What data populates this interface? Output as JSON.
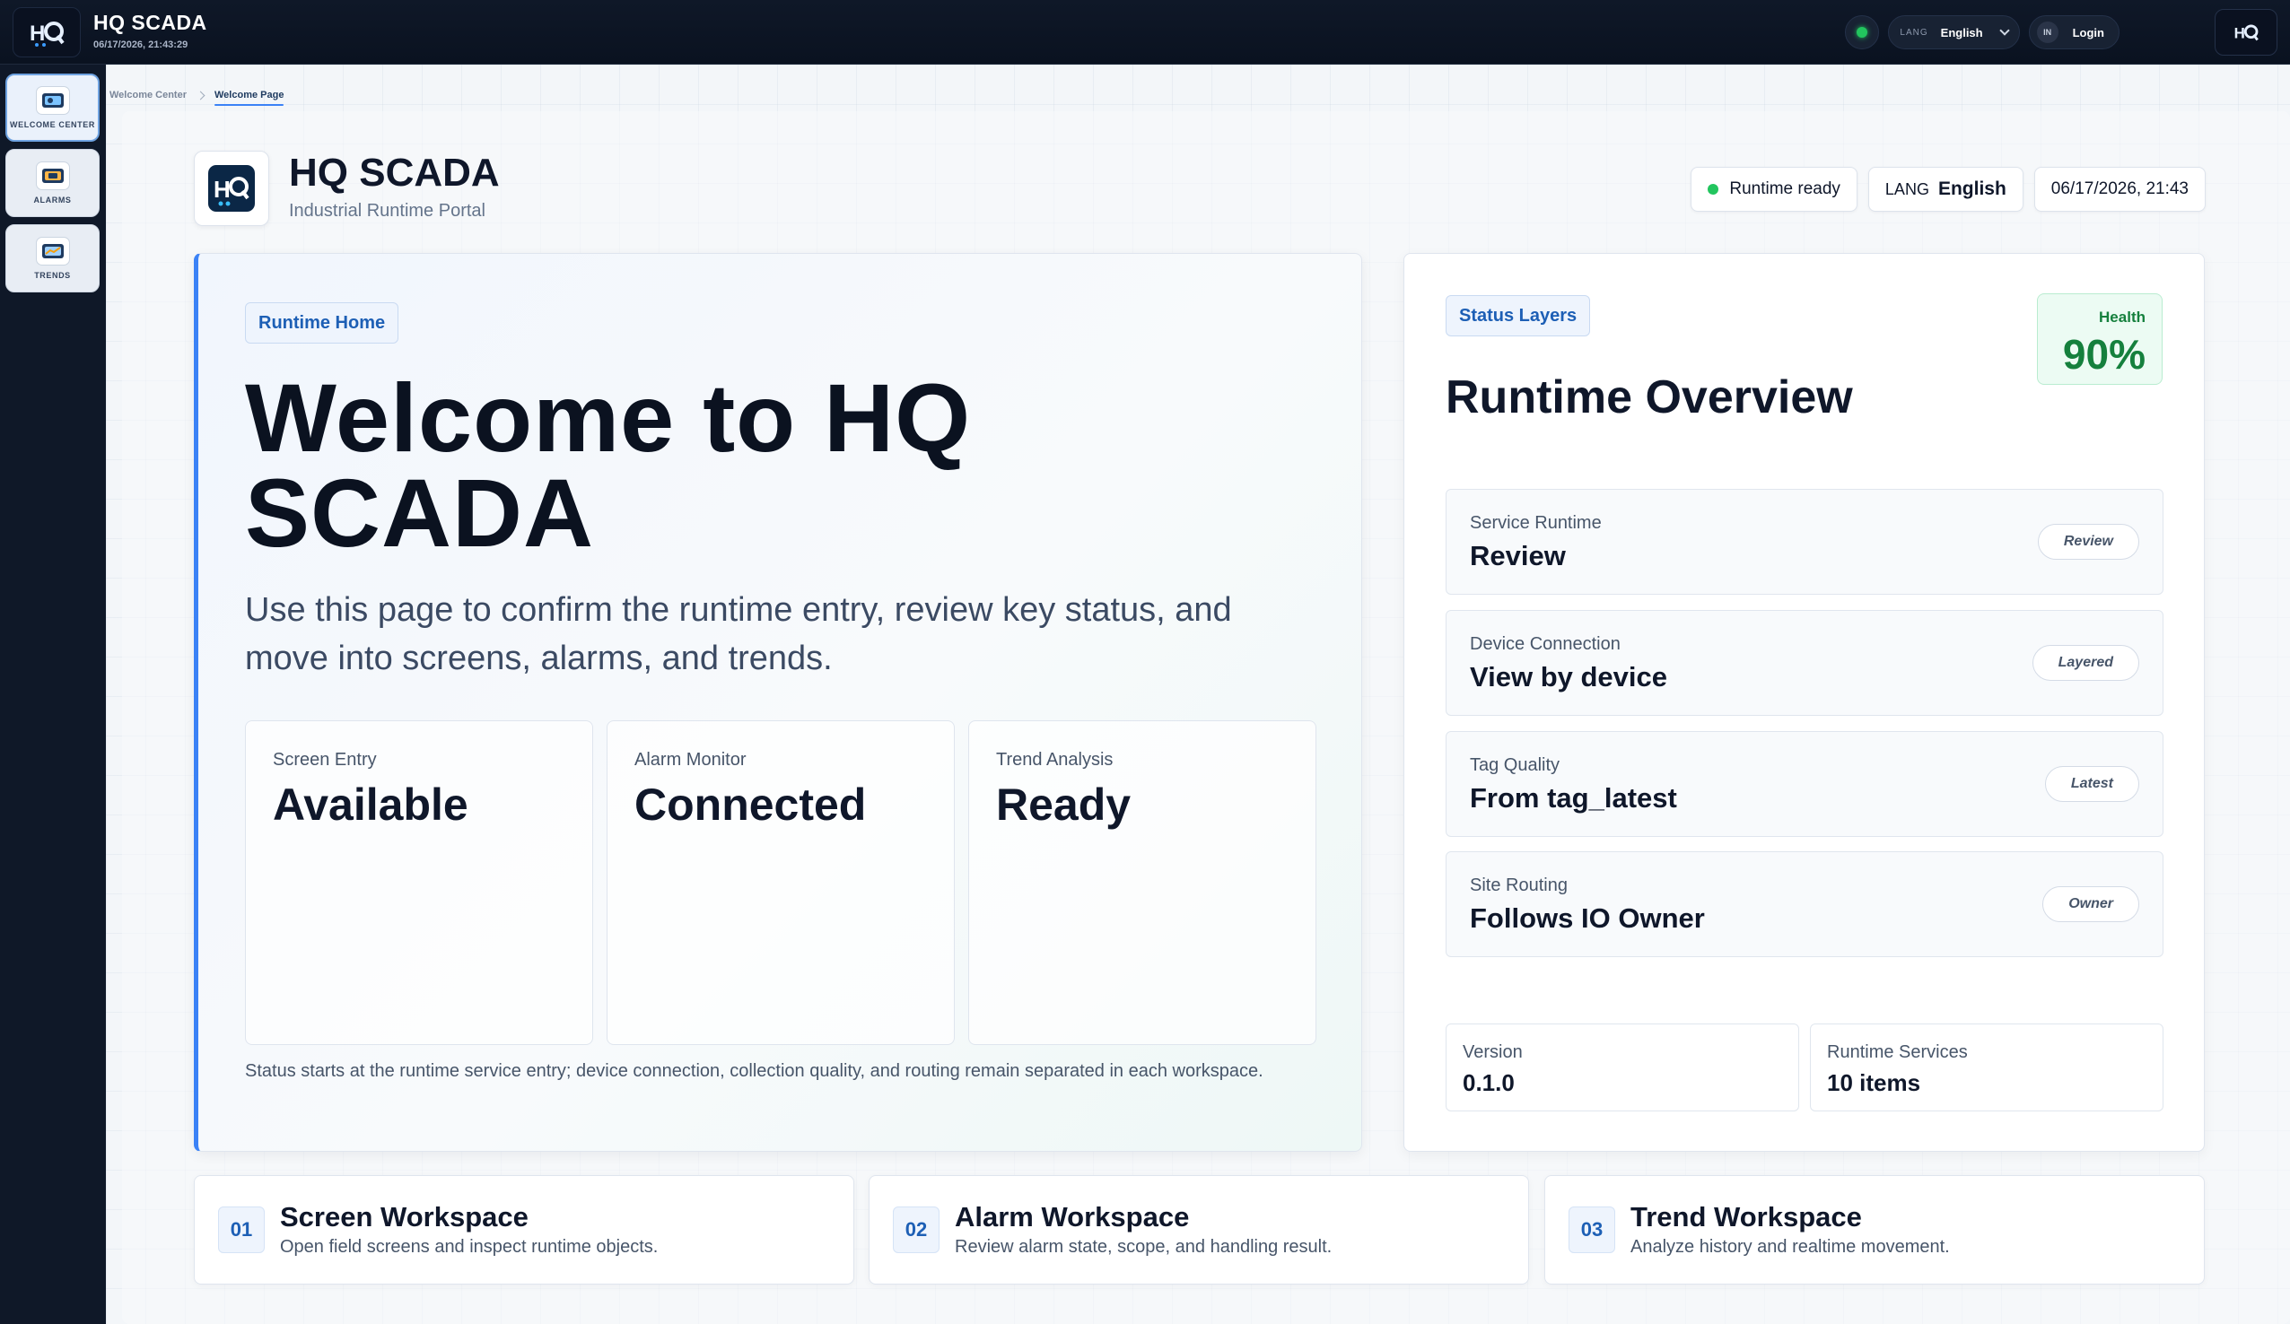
{
  "topbar": {
    "title": "HQ SCADA",
    "datetime": "06/17/2026, 21:43:29",
    "logo_text": "HQ",
    "lang_key": "LANG",
    "lang_value": "English",
    "login_key": "IN",
    "login_label": "Login",
    "status_color": "#22c55e"
  },
  "sidebar": {
    "items": [
      {
        "label": "WELCOME CENTER",
        "icon": "welcome-icon",
        "active": true
      },
      {
        "label": "ALARMS",
        "icon": "alarms-icon",
        "active": false
      },
      {
        "label": "TRENDS",
        "icon": "trends-icon",
        "active": false
      }
    ]
  },
  "breadcrumb": {
    "parent": "Welcome Center",
    "current": "Welcome Page"
  },
  "header": {
    "logo_text": "HQ",
    "title": "HQ SCADA",
    "subtitle": "Industrial Runtime Portal",
    "runtime_status": "Runtime ready",
    "lang_key": "LANG",
    "lang_value": "English",
    "datetime": "06/17/2026, 21:43"
  },
  "welcome": {
    "tag": "Runtime Home",
    "title_line1": "Welcome to HQ",
    "title_line2": "SCADA",
    "description": "Use this page to confirm the runtime entry, review key status, and move into screens, alarms, and trends.",
    "stats": [
      {
        "label": "Screen Entry",
        "value": "Available"
      },
      {
        "label": "Alarm Monitor",
        "value": "Connected"
      },
      {
        "label": "Trend Analysis",
        "value": "Ready"
      }
    ],
    "footnote": "Status starts at the runtime service entry; device connection, collection quality, and routing remain separated in each workspace."
  },
  "overview": {
    "tag": "Status Layers",
    "title": "Runtime Overview",
    "health_label": "Health",
    "health_value": "90%",
    "rows": [
      {
        "label": "Service Runtime",
        "value": "Review",
        "badge": "Review"
      },
      {
        "label": "Device Connection",
        "value": "View by device",
        "badge": "Layered"
      },
      {
        "label": "Tag Quality",
        "value": "From tag_latest",
        "badge": "Latest"
      },
      {
        "label": "Site Routing",
        "value": "Follows IO Owner",
        "badge": "Owner"
      }
    ],
    "version_label": "Version",
    "version_value": "0.1.0",
    "services_label": "Runtime Services",
    "services_value": "10 items"
  },
  "workspaces": [
    {
      "num": "01",
      "title": "Screen Workspace",
      "desc": "Open field screens and inspect runtime objects."
    },
    {
      "num": "02",
      "title": "Alarm Workspace",
      "desc": "Review alarm state, scope, and handling result."
    },
    {
      "num": "03",
      "title": "Trend Workspace",
      "desc": "Analyze history and realtime movement."
    }
  ],
  "colors": {
    "accent": "#3b82f6",
    "health": "#15803d",
    "topbar": "#0f1828"
  }
}
